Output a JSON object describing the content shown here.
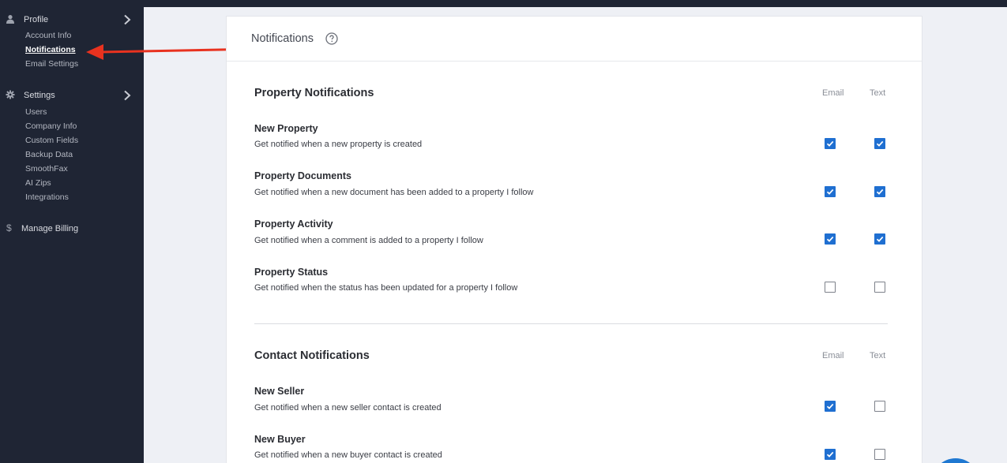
{
  "sidebar": {
    "profile": {
      "label": "Profile",
      "items": [
        "Account Info",
        "Notifications",
        "Email Settings"
      ]
    },
    "settings": {
      "label": "Settings",
      "items": [
        "Users",
        "Company Info",
        "Custom Fields",
        "Backup Data",
        "SmoothFax",
        "AI Zips",
        "Integrations"
      ]
    },
    "billing": {
      "label": "Manage Billing"
    },
    "active_item": "Notifications"
  },
  "panel": {
    "title": "Notifications",
    "property_section": {
      "title": "Property Notifications",
      "col_email": "Email",
      "col_text": "Text",
      "items": [
        {
          "title": "New Property",
          "desc": "Get notified when a new property is created",
          "email": true,
          "text": true
        },
        {
          "title": "Property Documents",
          "desc": "Get notified when a new document has been added to a property I follow",
          "email": true,
          "text": true
        },
        {
          "title": "Property Activity",
          "desc": "Get notified when a comment is added to a property I follow",
          "email": true,
          "text": true
        },
        {
          "title": "Property Status",
          "desc": "Get notified when the status has been updated for a property I follow",
          "email": false,
          "text": false
        }
      ]
    },
    "contact_section": {
      "title": "Contact Notifications",
      "col_email": "Email",
      "col_text": "Text",
      "items": [
        {
          "title": "New Seller",
          "desc": "Get notified when a new seller contact is created",
          "email": true,
          "text": false
        },
        {
          "title": "New Buyer",
          "desc": "Get notified when a new buyer contact is created",
          "email": true,
          "text": false
        }
      ]
    }
  },
  "colors": {
    "sidebar_bg": "#1f2534",
    "checkbox_checked": "#1f6fd1",
    "annotation_arrow": "#e8321f"
  }
}
